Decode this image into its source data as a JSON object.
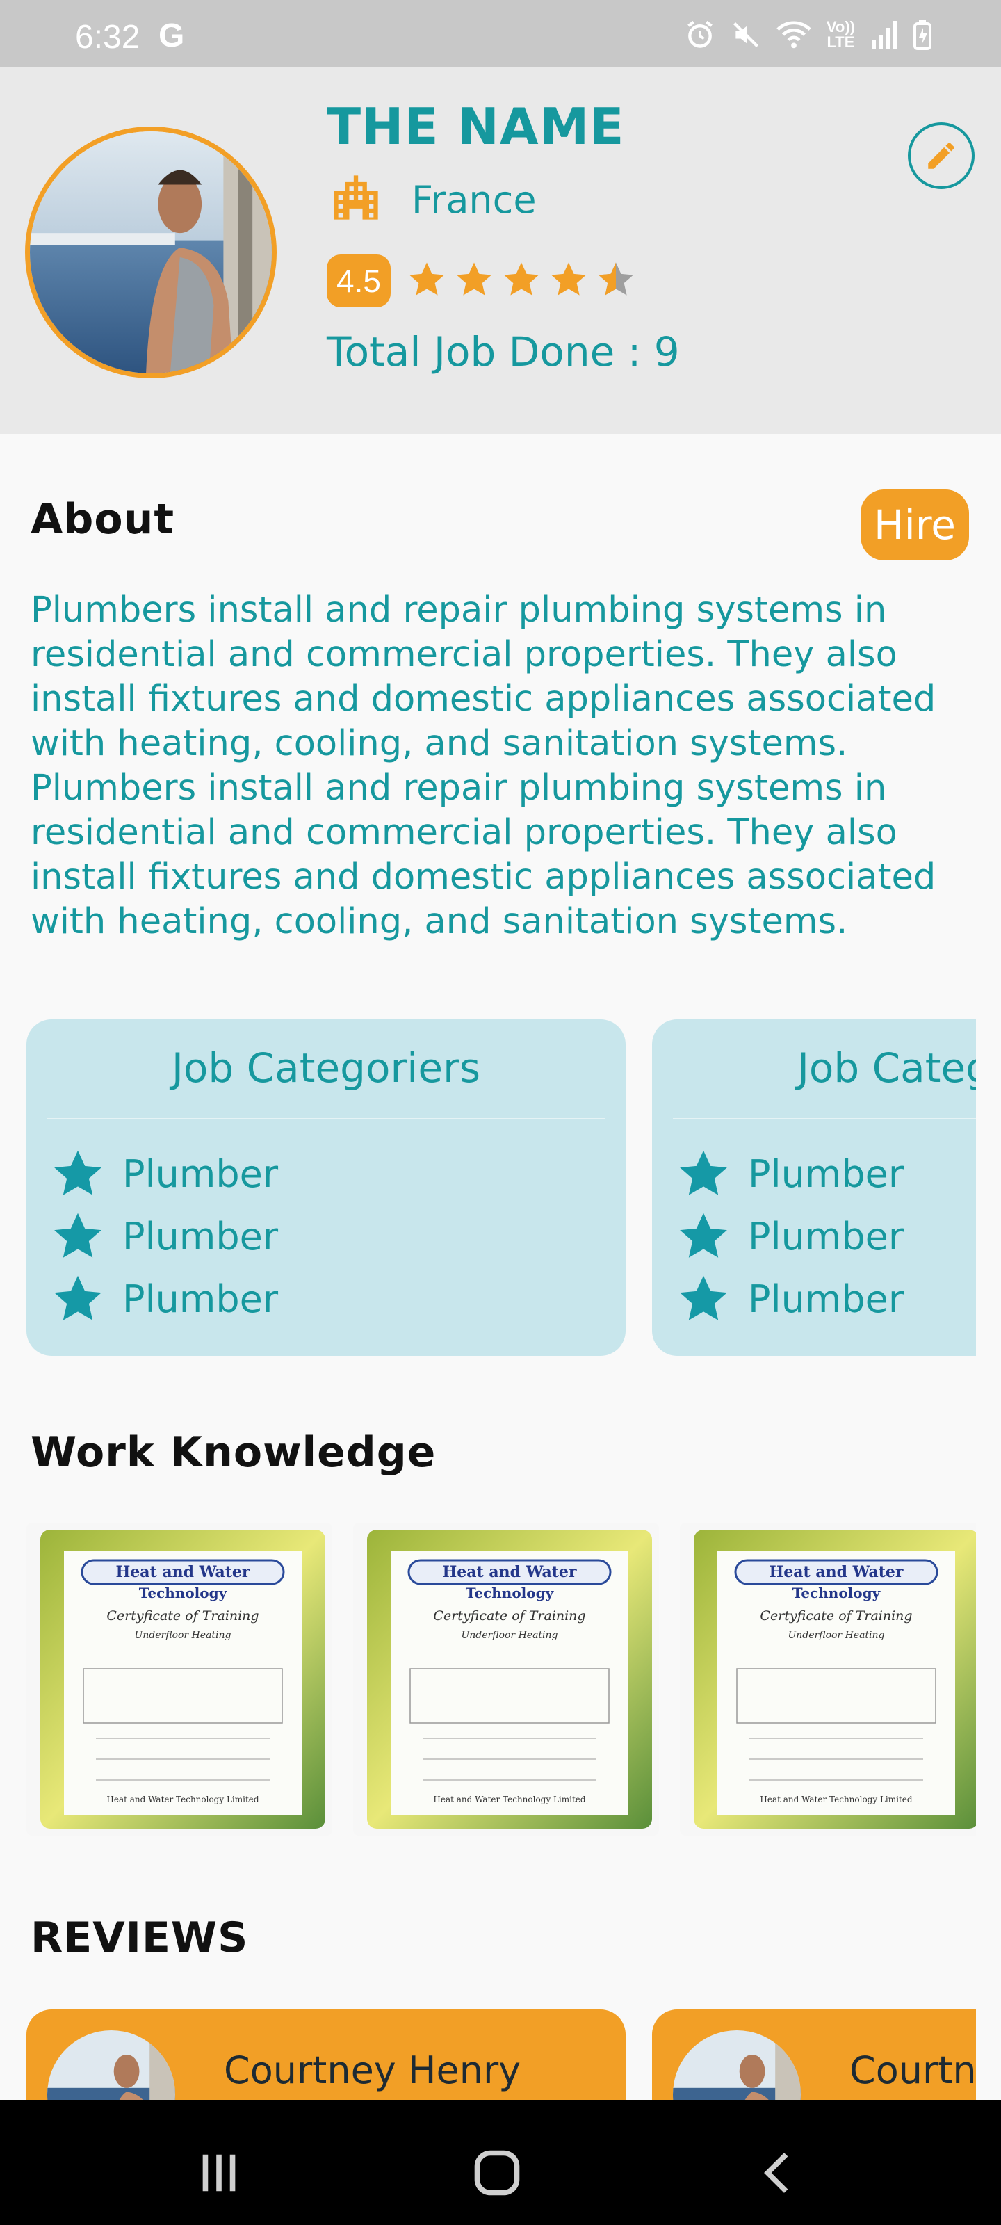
{
  "status_bar": {
    "time": "6:32",
    "carrier_icon": "G",
    "lte_label_top": "Vo))",
    "lte_label_bottom": "LTE"
  },
  "profile": {
    "name": "THE NAME",
    "location": "France",
    "rating": "4.5",
    "rating_value": 4.5,
    "rating_max": 5,
    "total_jobs": "Total Job Done : 9"
  },
  "about": {
    "title": "About",
    "hire_label": "Hire",
    "text": "Plumbers install and repair plumbing systems in residential and commercial properties. They also install fixtures and domestic appliances associated with heating, cooling, and sanitation systems. Plumbers install and repair plumbing systems in residential and commercial properties. They also install fixtures and domestic appliances associated with heating, cooling, and sanitation systems."
  },
  "categories": {
    "cards": [
      {
        "title": "Job Categoriers",
        "items": [
          "Plumber",
          "Plumber",
          "Plumber"
        ]
      },
      {
        "title": "Job Categoriers",
        "items": [
          "Plumber",
          "Plumber",
          "Plumber"
        ]
      }
    ]
  },
  "work_knowledge": {
    "title": "Work Knowledge",
    "certificates": [
      {
        "line1": "Heat and Water",
        "line2": "Technology",
        "line3": "Certyficate of Training",
        "line4": "Underfloor Heating",
        "footer": "Heat and Water Technology Limited"
      },
      {
        "line1": "Heat and Water",
        "line2": "Technology",
        "line3": "Certyficate of Training",
        "line4": "Underfloor Heating",
        "footer": "Heat and Water Technology Limited"
      },
      {
        "line1": "Heat and Water",
        "line2": "Technology",
        "line3": "Certyficate of Training",
        "line4": "Underfloor Heating",
        "footer": "Heat and Water Technology Limited"
      }
    ]
  },
  "reviews": {
    "title": "REVIEWS",
    "cards": [
      {
        "name": "Courtney Henry"
      },
      {
        "name": "Courtney Henry"
      }
    ]
  },
  "colors": {
    "teal": "#16989e",
    "orange": "#f29f26",
    "card_bg": "#c8e6ec",
    "header_bg": "#e9e9e9"
  },
  "icons": {
    "edit": "pencil-icon",
    "location": "city-buildings-icon",
    "category_bullet": "star-icon",
    "nav_recents": "recents-icon",
    "nav_home": "home-icon",
    "nav_back": "back-icon"
  }
}
